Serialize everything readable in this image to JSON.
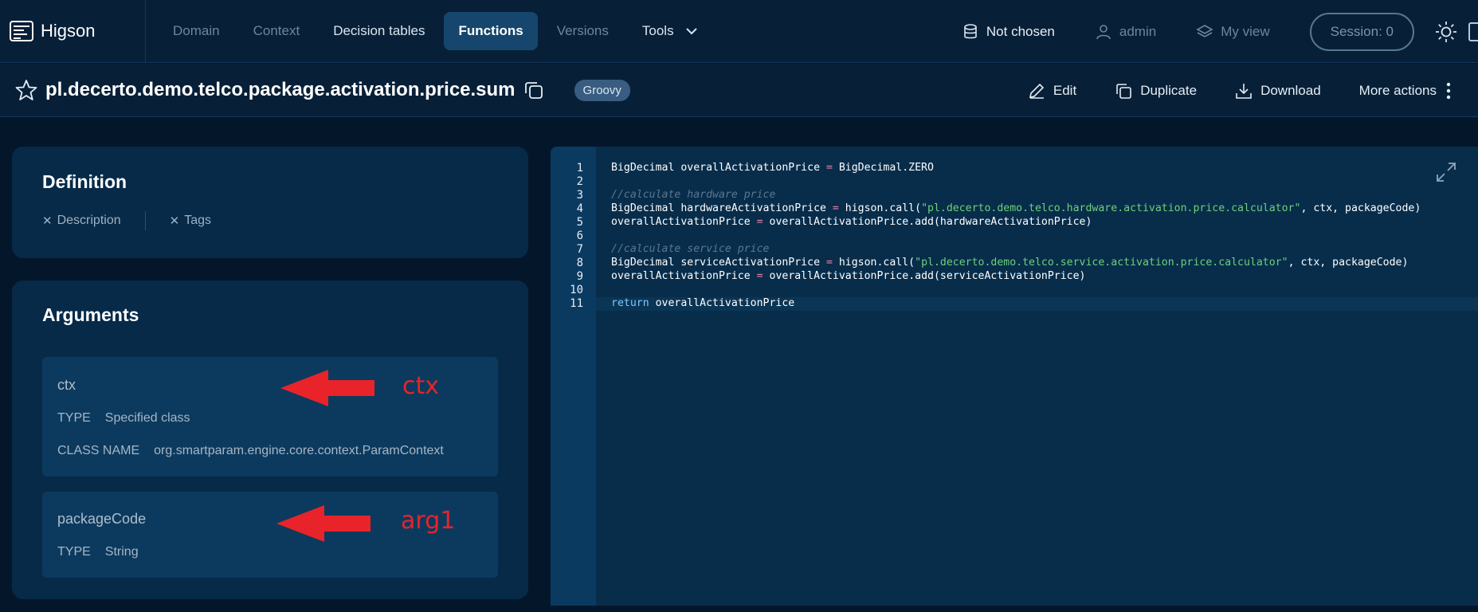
{
  "brand": {
    "name": "Higson"
  },
  "nav": {
    "items": [
      {
        "label": "Domain"
      },
      {
        "label": "Context"
      },
      {
        "label": "Decision tables"
      },
      {
        "label": "Functions"
      },
      {
        "label": "Versions"
      },
      {
        "label": "Tools"
      }
    ],
    "active": "Functions"
  },
  "top_right": {
    "database_label": "Not chosen",
    "user_label": "admin",
    "view_label": "My view",
    "session_label": "Session: 0"
  },
  "function": {
    "name": "pl.decerto.demo.telco.package.activation.price.sum",
    "language": "Groovy"
  },
  "actions": {
    "edit": "Edit",
    "duplicate": "Duplicate",
    "download": "Download",
    "more": "More actions"
  },
  "definition": {
    "title": "Definition",
    "description_label": "Description",
    "tags_label": "Tags"
  },
  "arguments": {
    "title": "Arguments",
    "items": [
      {
        "name": "ctx",
        "type_key": "TYPE",
        "type_value": "Specified class",
        "class_key": "CLASS NAME",
        "class_value": "org.smartparam.engine.core.context.ParamContext",
        "annotation": "ctx"
      },
      {
        "name": "packageCode",
        "type_key": "TYPE",
        "type_value": "String",
        "annotation": "arg1"
      }
    ]
  },
  "editor": {
    "line_numbers": [
      "1",
      "2",
      "3",
      "4",
      "5",
      "6",
      "7",
      "8",
      "9",
      "10",
      "11"
    ],
    "lines": {
      "l1_type": "BigDecimal overallActivationPrice ",
      "l1_eq": "=",
      "l1_rest": " BigDecimal.ZERO",
      "l3": "//calculate hardware price",
      "l4_pre": "BigDecimal hardwareActivationPrice ",
      "l4_eq": "=",
      "l4_call": " higson.call(",
      "l4_str": "\"pl.decerto.demo.telco.hardware.activation.price.calculator\"",
      "l4_post": ", ctx, packageCode)",
      "l5_pre": "overallActivationPrice ",
      "l5_eq": "=",
      "l5_post": " overallActivationPrice.add(hardwareActivationPrice)",
      "l7": "//calculate service price",
      "l8_pre": "BigDecimal serviceActivationPrice ",
      "l8_eq": "=",
      "l8_call": " higson.call(",
      "l8_str": "\"pl.decerto.demo.telco.service.activation.price.calculator\"",
      "l8_post": ", ctx, packageCode)",
      "l9_pre": "overallActivationPrice ",
      "l9_eq": "=",
      "l9_post": " overallActivationPrice.add(serviceActivationPrice)",
      "l11_kw": "return",
      "l11_post": " overallActivationPrice"
    }
  },
  "colors": {
    "background": "#04172a",
    "panel": "#062a48",
    "accent_active_tab": "#16466d",
    "annotation_red": "#e8232a",
    "string_green": "#6fd07a"
  },
  "icons": [
    "menu-logo-icon",
    "chevron-down-icon",
    "database-icon",
    "user-icon",
    "layers-icon",
    "sun-icon",
    "star-icon",
    "copy-icon",
    "pencil-icon",
    "duplicate-icon",
    "download-icon",
    "kebab-icon",
    "close-icon",
    "expand-icon",
    "red-arrow-icon"
  ]
}
